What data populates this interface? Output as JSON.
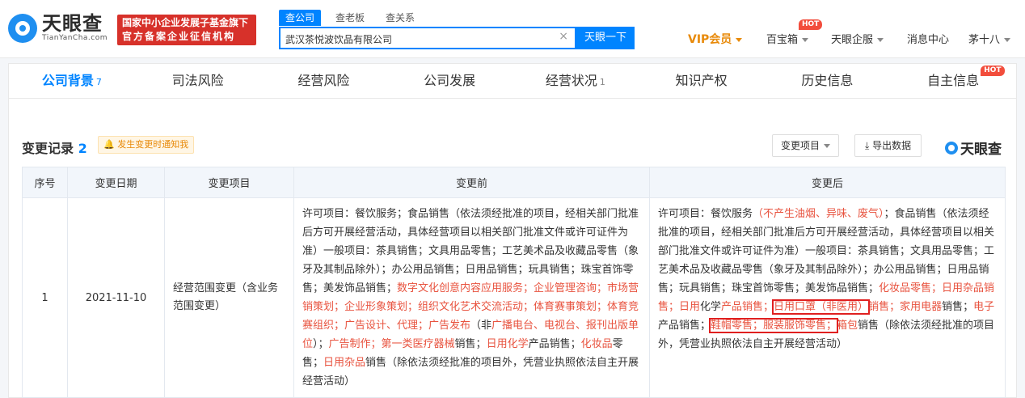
{
  "header": {
    "logo_cn": "天眼查",
    "logo_en": "TianYanCha.com",
    "badge_line1": "国家中小企业发展子基金旗下",
    "badge_line2": "官方备案企业征信机构",
    "search_tabs": [
      "查公司",
      "查老板",
      "查关系"
    ],
    "search_value": "武汉茶悦波饮品有限公司",
    "search_button": "天眼一下",
    "nav": {
      "vip": "VIP会员",
      "baibaoxiang": "百宝箱",
      "qiye": "天眼企服",
      "messages": "消息中心",
      "user": "茅十八",
      "hot": "HOT"
    }
  },
  "tabs": [
    {
      "label": "公司背景",
      "count": "7"
    },
    {
      "label": "司法风险",
      "count": ""
    },
    {
      "label": "经营风险",
      "count": ""
    },
    {
      "label": "公司发展",
      "count": ""
    },
    {
      "label": "经营状况",
      "count": "1"
    },
    {
      "label": "知识产权",
      "count": ""
    },
    {
      "label": "历史信息",
      "count": ""
    },
    {
      "label": "自主信息",
      "count": ""
    }
  ],
  "section": {
    "title": "变更记录",
    "count": "2",
    "notify": "发生变更时通知我",
    "filter_button": "变更项目",
    "export_button": "导出数据",
    "brand": "天眼查"
  },
  "table": {
    "headers": [
      "序号",
      "变更日期",
      "变更项目",
      "变更前",
      "变更后"
    ],
    "row": {
      "index": "1",
      "date": "2021-11-10",
      "item": "经营范围变更（含业务范围变更）"
    },
    "before": [
      {
        "t": "许可项目：餐饮服务；食品销售（依法须经批准的项目，经相关部门批准后方可开展经营活动，具体经营项目以相关部门批准文件或许可证件为准）一般项目：茶具销售；文具用品零售；工艺美术品及收藏品零售（象牙及其制品除外）；办公用品销售；日用品销售；玩具销售；珠宝首饰零售；美发饰品销售；",
        "h": false
      },
      {
        "t": "数字文化创意内容应用服务；企业管理咨询；市场营销策划；企业形象策划；组织文化艺术交流活动；体育赛事策划；体育竞赛组织；广告设计、代理；广告发布",
        "h": true
      },
      {
        "t": "（非",
        "h": false
      },
      {
        "t": "广播电台、电视台、报刊出版单位",
        "h": true
      },
      {
        "t": "）；",
        "h": false
      },
      {
        "t": "广告制作；第一类医疗器械",
        "h": true
      },
      {
        "t": "销售；",
        "h": false
      },
      {
        "t": "日用化学",
        "h": true
      },
      {
        "t": "产品销售；",
        "h": false
      },
      {
        "t": "化妆品",
        "h": true
      },
      {
        "t": "零售；",
        "h": false
      },
      {
        "t": "日用杂品",
        "h": true
      },
      {
        "t": "销售（除依法须经批准的项目外，凭营业执照依法自主开展经营活动）",
        "h": false
      }
    ],
    "after": [
      {
        "t": "许可项目：餐饮服务",
        "h": false,
        "b": false
      },
      {
        "t": "（不产生油烟、异味、废气）",
        "h": true,
        "b": false
      },
      {
        "t": "；食品销售（依法须经批准的项目，经相关部门批准后方可开展经营活动，具体经营项目以相关部门批准文件或许可证件为准）一般项目：茶具销售；文具用品零售；工艺美术品及收藏品零售（象牙及其制品除外）；办公用品销售；日用品销售；玩具销售；珠宝首饰零售；美发饰品销售；",
        "h": false,
        "b": false
      },
      {
        "t": "化妆品零售；日用杂品销售；日用",
        "h": true,
        "b": false
      },
      {
        "t": "化学",
        "h": false,
        "b": false
      },
      {
        "t": "产品销售；",
        "h": true,
        "b": false
      },
      {
        "t": "日用口罩（非医用）",
        "h": true,
        "b": true
      },
      {
        "t": "销售；",
        "h": true,
        "b": false
      },
      {
        "t": "家用电器",
        "h": true,
        "b": false
      },
      {
        "t": "销售；",
        "h": false,
        "b": false
      },
      {
        "t": "电子",
        "h": true,
        "b": false
      },
      {
        "t": "产品销售；",
        "h": false,
        "b": false
      },
      {
        "t": "鞋帽零售；服装服饰零售；",
        "h": true,
        "b": true
      },
      {
        "t": "箱包",
        "h": true,
        "b": false
      },
      {
        "t": "销售（除依法须经批准的项目外，凭营业执照依法自主开展经营活动）",
        "h": false,
        "b": false
      }
    ]
  }
}
